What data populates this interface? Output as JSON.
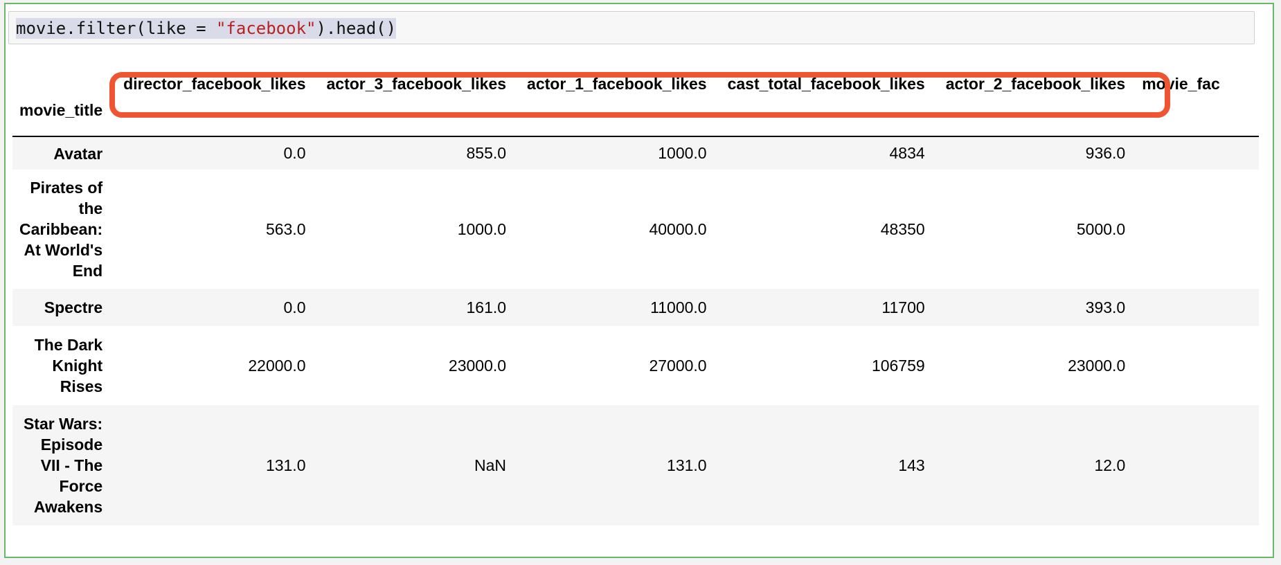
{
  "cell": {
    "code_parts": {
      "prefix": "movie.filter(like = ",
      "string": "\"facebook\"",
      "suffix": ").head()"
    }
  },
  "table": {
    "index_name": "movie_title",
    "columns": [
      "director_facebook_likes",
      "actor_3_facebook_likes",
      "actor_1_facebook_likes",
      "cast_total_facebook_likes",
      "actor_2_facebook_likes",
      "movie_fac"
    ],
    "rows": [
      {
        "title": "Avatar",
        "values": [
          "0.0",
          "855.0",
          "1000.0",
          "4834",
          "936.0",
          ""
        ]
      },
      {
        "title": "Pirates of the Caribbean: At World's End",
        "values": [
          "563.0",
          "1000.0",
          "40000.0",
          "48350",
          "5000.0",
          ""
        ]
      },
      {
        "title": "Spectre",
        "values": [
          "0.0",
          "161.0",
          "11000.0",
          "11700",
          "393.0",
          ""
        ]
      },
      {
        "title": "The Dark Knight Rises",
        "values": [
          "22000.0",
          "23000.0",
          "27000.0",
          "106759",
          "23000.0",
          ""
        ]
      },
      {
        "title": "Star Wars: Episode VII - The Force Awakens",
        "values": [
          "131.0",
          "NaN",
          "131.0",
          "143",
          "12.0",
          ""
        ]
      }
    ]
  },
  "colors": {
    "highlight_border": "#ef5530",
    "cell_border": "#66bb6a",
    "string_color": "#ba2121"
  }
}
